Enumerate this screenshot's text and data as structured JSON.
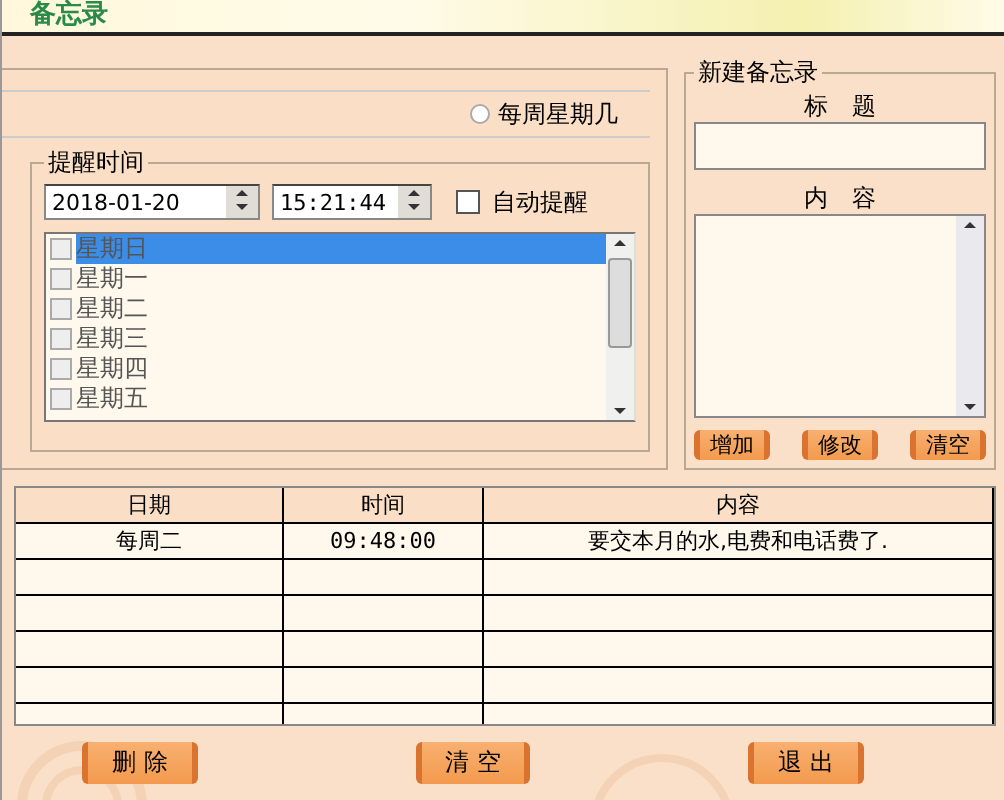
{
  "window": {
    "title": "备忘录"
  },
  "repeat_option": {
    "label": "每周星期几",
    "selected": false
  },
  "reminder": {
    "legend": "提醒时间",
    "date": "2018-01-20",
    "time": "15:21:44",
    "auto_remind": {
      "label": "自动提醒",
      "checked": false
    },
    "weekdays": [
      {
        "label": "星期日",
        "checked": false,
        "selected": true
      },
      {
        "label": "星期一",
        "checked": false,
        "selected": false
      },
      {
        "label": "星期二",
        "checked": false,
        "selected": false
      },
      {
        "label": "星期三",
        "checked": false,
        "selected": false
      },
      {
        "label": "星期四",
        "checked": false,
        "selected": false
      },
      {
        "label": "星期五",
        "checked": false,
        "selected": false
      }
    ]
  },
  "new_memo": {
    "legend": "新建备忘录",
    "title_label": "标　题",
    "content_label": "内　容",
    "buttons": [
      "增加",
      "修改",
      "清空"
    ]
  },
  "table": {
    "columns": [
      "日期",
      "时间",
      "内容"
    ],
    "rows": [
      [
        "每周二",
        "09:48:00",
        "要交本月的水,电费和电话费了."
      ]
    ]
  },
  "buttons": [
    "删 除",
    "清 空",
    "退 出"
  ]
}
